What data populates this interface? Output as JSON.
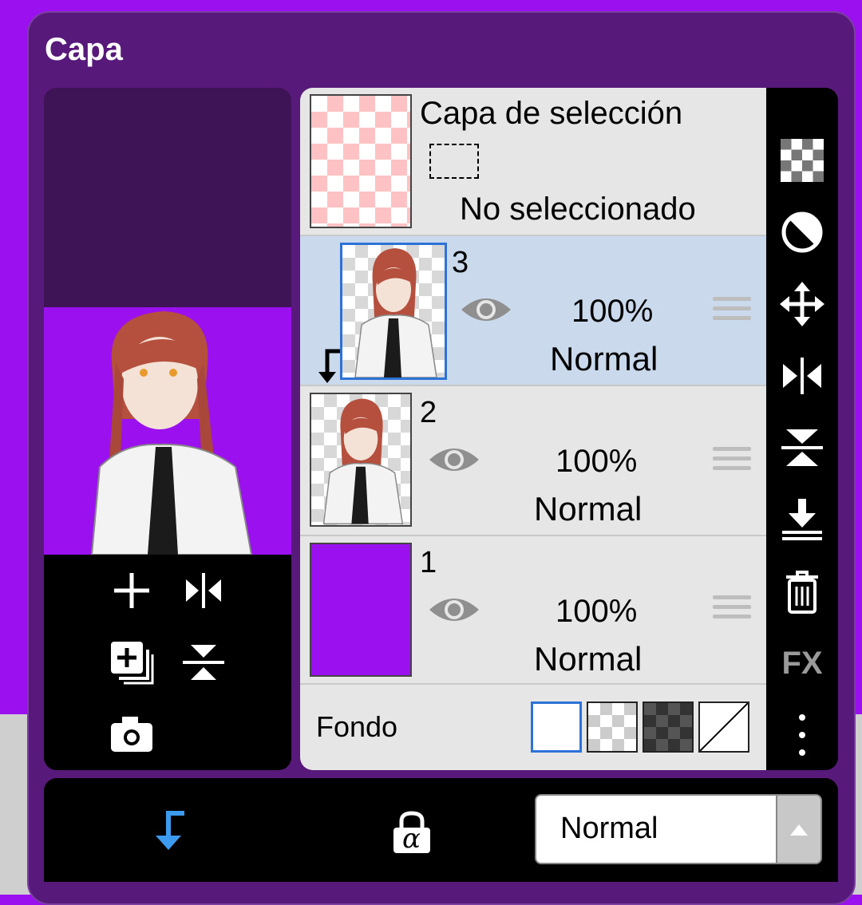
{
  "panel": {
    "title": "Capa"
  },
  "selection_layer": {
    "title": "Capa de selección",
    "status": "No seleccionado"
  },
  "layers": [
    {
      "number": "3",
      "opacity": "100%",
      "blend": "Normal",
      "selected": true,
      "clipping": true
    },
    {
      "number": "2",
      "opacity": "100%",
      "blend": "Normal",
      "selected": false
    },
    {
      "number": "1",
      "opacity": "100%",
      "blend": "Normal",
      "selected": false,
      "fill": "#9a10ee"
    }
  ],
  "background": {
    "label": "Fondo",
    "options": [
      "white",
      "transparent-light",
      "transparent-dark",
      "custom"
    ],
    "selected": "white"
  },
  "right_toolbar": {
    "icons": [
      "checker-icon",
      "invert-icon",
      "move-icon",
      "flip-horizontal-icon",
      "flip-vertical-icon",
      "merge-down-icon",
      "trash-icon",
      "fx-icon",
      "more-icon"
    ],
    "fx_label": "FX"
  },
  "left_toolbar": {
    "icons": [
      "add-layer-icon",
      "flip-horizontal-icon",
      "duplicate-layer-icon",
      "flip-vertical-icon",
      "camera-icon"
    ]
  },
  "bottom_bar": {
    "blend_mode": "Normal",
    "lock_label": "α"
  },
  "colors": {
    "accent": "#9a10ee",
    "selected_row": "#cbd9ec",
    "clip_blue": "#3c9bef",
    "panel": "#57197a"
  }
}
